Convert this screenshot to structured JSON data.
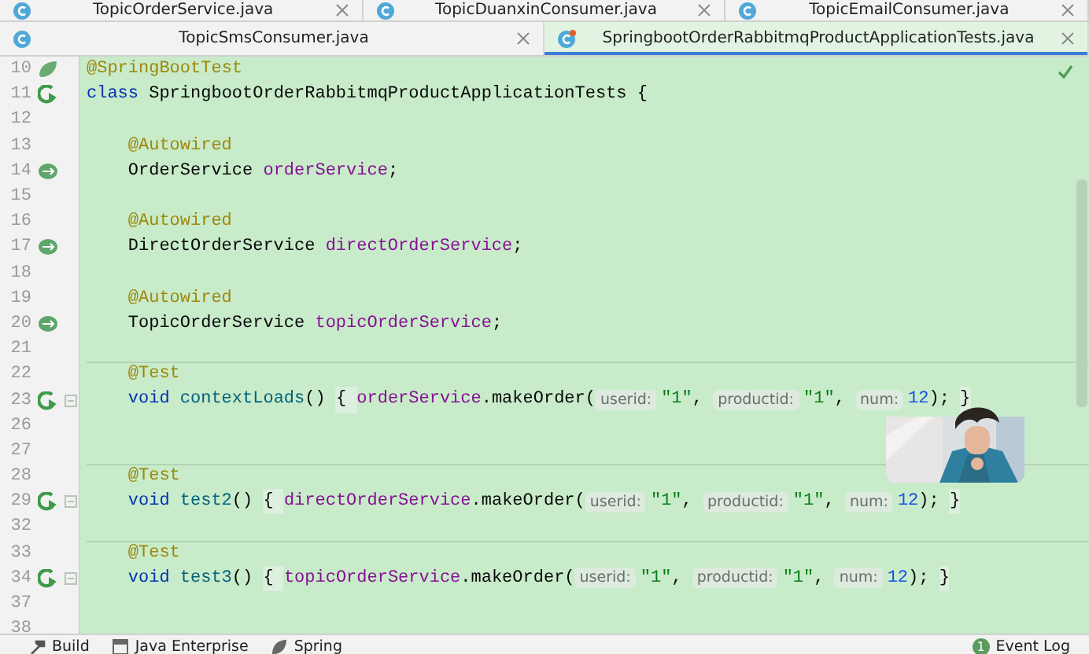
{
  "tabs_top": [
    {
      "label": "TopicOrderService.java",
      "selected": false
    },
    {
      "label": "TopicDuanxinConsumer.java",
      "selected": false
    },
    {
      "label": "TopicEmailConsumer.java",
      "selected": false
    }
  ],
  "tabs": [
    {
      "label": "TopicSmsConsumer.java",
      "selected": false,
      "modified": false
    },
    {
      "label": "SpringbootOrderRabbitmqProductApplicationTests.java",
      "selected": true,
      "modified": true
    }
  ],
  "editor": {
    "lines": [
      {
        "number": "10",
        "kind": "spring",
        "segments": [
          {
            "kind": "annotation",
            "text": "@SpringBootTest"
          }
        ]
      },
      {
        "number": "11",
        "kind": "run",
        "segments": [
          {
            "kind": "keyword",
            "text": "class "
          },
          {
            "kind": "plain",
            "text": "SpringbootOrderRabbitmqProductApplicationTests {"
          }
        ]
      },
      {
        "number": "12"
      },
      {
        "number": "13",
        "indented": true,
        "segments": [
          {
            "kind": "annotation",
            "text": "@Autowired"
          }
        ]
      },
      {
        "number": "14",
        "kind": "bean",
        "indented": true,
        "segments": [
          {
            "kind": "plain",
            "text": "OrderService "
          },
          {
            "kind": "field",
            "text": "orderService"
          },
          {
            "kind": "plain",
            "text": ";"
          }
        ]
      },
      {
        "number": "15"
      },
      {
        "number": "16",
        "indented": true,
        "segments": [
          {
            "kind": "annotation",
            "text": "@Autowired"
          }
        ]
      },
      {
        "number": "17",
        "kind": "bean",
        "indented": true,
        "segments": [
          {
            "kind": "plain",
            "text": "DirectOrderService "
          },
          {
            "kind": "field",
            "text": "directOrderService"
          },
          {
            "kind": "plain",
            "text": ";"
          }
        ]
      },
      {
        "number": "18"
      },
      {
        "number": "19",
        "indented": true,
        "segments": [
          {
            "kind": "annotation",
            "text": "@Autowired"
          }
        ]
      },
      {
        "number": "20",
        "kind": "bean",
        "indented": true,
        "segments": [
          {
            "kind": "plain",
            "text": "TopicOrderService "
          },
          {
            "kind": "field",
            "text": "topicOrderService"
          },
          {
            "kind": "plain",
            "text": ";"
          }
        ]
      },
      {
        "number": "21"
      },
      {
        "number": "22",
        "separator": true,
        "indented": true,
        "segments": [
          {
            "kind": "annotation",
            "text": "@Test"
          }
        ]
      },
      {
        "number": "23",
        "kind": "run",
        "folded": true,
        "indented": true,
        "segments": [
          {
            "kind": "keyword",
            "text": "void "
          },
          {
            "kind": "method",
            "text": "contextLoads"
          },
          {
            "kind": "plain",
            "text": "() "
          },
          {
            "kind": "fold",
            "text": "{ "
          },
          {
            "kind": "field",
            "text": "orderService"
          },
          {
            "kind": "plain",
            "text": ".makeOrder("
          },
          {
            "kind": "hint",
            "text": "userid:"
          },
          {
            "kind": "string",
            "text": "\"1\""
          },
          {
            "kind": "plain",
            "text": ", "
          },
          {
            "kind": "hint",
            "text": "productid:"
          },
          {
            "kind": "string",
            "text": "\"1\""
          },
          {
            "kind": "plain",
            "text": ", "
          },
          {
            "kind": "hint",
            "text": "num:"
          },
          {
            "kind": "number",
            "text": "12"
          },
          {
            "kind": "plain",
            "text": "); "
          },
          {
            "kind": "fold",
            "text": "}"
          }
        ]
      },
      {
        "number": "26"
      },
      {
        "number": "27"
      },
      {
        "number": "28",
        "separator": true,
        "indented": true,
        "segments": [
          {
            "kind": "annotation",
            "text": "@Test"
          }
        ]
      },
      {
        "number": "29",
        "kind": "run",
        "folded": true,
        "indented": true,
        "segments": [
          {
            "kind": "keyword",
            "text": "void "
          },
          {
            "kind": "method",
            "text": "test2"
          },
          {
            "kind": "plain",
            "text": "() "
          },
          {
            "kind": "fold",
            "text": "{ "
          },
          {
            "kind": "field",
            "text": "directOrderService"
          },
          {
            "kind": "plain",
            "text": ".makeOrder("
          },
          {
            "kind": "hint",
            "text": "userid:"
          },
          {
            "kind": "string",
            "text": "\"1\""
          },
          {
            "kind": "plain",
            "text": ", "
          },
          {
            "kind": "hint",
            "text": "productid:"
          },
          {
            "kind": "string",
            "text": "\"1\""
          },
          {
            "kind": "plain",
            "text": ", "
          },
          {
            "kind": "hint",
            "text": "num:"
          },
          {
            "kind": "number",
            "text": "12"
          },
          {
            "kind": "plain",
            "text": "); "
          },
          {
            "kind": "fold",
            "text": "}"
          }
        ]
      },
      {
        "number": "32"
      },
      {
        "number": "33",
        "separator": true,
        "indented": true,
        "segments": [
          {
            "kind": "annotation",
            "text": "@Test"
          }
        ]
      },
      {
        "number": "34",
        "kind": "run",
        "folded": true,
        "indented": true,
        "segments": [
          {
            "kind": "keyword",
            "text": "void "
          },
          {
            "kind": "method",
            "text": "test3"
          },
          {
            "kind": "plain",
            "text": "() "
          },
          {
            "kind": "fold",
            "text": "{ "
          },
          {
            "kind": "field",
            "text": "topicOrderService"
          },
          {
            "kind": "plain",
            "text": ".makeOrder("
          },
          {
            "kind": "hint",
            "text": "userid:"
          },
          {
            "kind": "string",
            "text": "\"1\""
          },
          {
            "kind": "plain",
            "text": ", "
          },
          {
            "kind": "hint",
            "text": "productid:"
          },
          {
            "kind": "string",
            "text": "\"1\""
          },
          {
            "kind": "plain",
            "text": ", "
          },
          {
            "kind": "hint",
            "text": "num:"
          },
          {
            "kind": "number",
            "text": "12"
          },
          {
            "kind": "plain",
            "text": "); "
          },
          {
            "kind": "fold",
            "text": "}"
          }
        ]
      },
      {
        "number": "37"
      },
      {
        "number": "38"
      }
    ]
  },
  "status_bar": {
    "tools": [
      {
        "label": "Build"
      },
      {
        "label": "Java Enterprise"
      },
      {
        "label": "Spring"
      }
    ],
    "event_log": {
      "label": "Event Log",
      "count": "1"
    }
  }
}
